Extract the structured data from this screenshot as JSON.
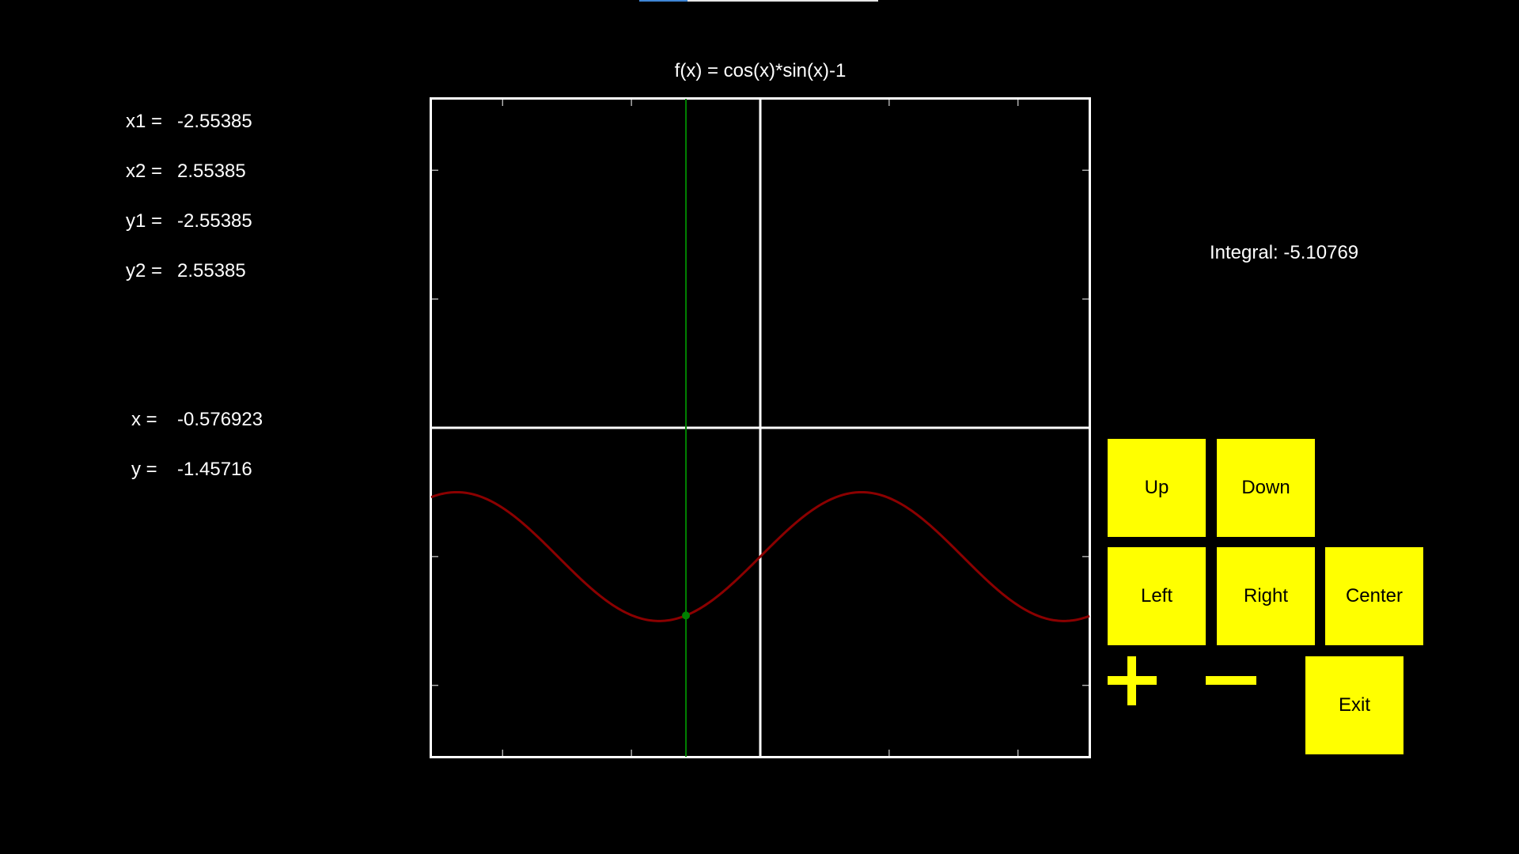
{
  "title": "f(x) = cos(x)*sin(x)-1",
  "range": {
    "x1_label": "x1 =",
    "x1": "-2.55385",
    "x2_label": "x2 =",
    "x2": "2.55385",
    "y1_label": "y1 =",
    "y1": "-2.55385",
    "y2_label": "y2 =",
    "y2": "2.55385"
  },
  "cursor": {
    "x_label": "x =",
    "x": "-0.576923",
    "y_label": "y =",
    "y": "-1.45716"
  },
  "integral": "Integral: -5.10769",
  "buttons": {
    "up": "Up",
    "down": "Down",
    "left": "Left",
    "right": "Right",
    "center": "Center",
    "exit": "Exit",
    "zoom_in_icon": "plus-icon",
    "zoom_out_icon": "minus-icon"
  },
  "colors": {
    "background": "#000000",
    "axes": "#ffffff",
    "curve": "#8b0000",
    "cursor_line": "#008000",
    "button": "#ffff00"
  },
  "chart_data": {
    "type": "line",
    "title": "f(x) = cos(x)*sin(x)-1",
    "xlim": [
      -2.55385,
      2.55385
    ],
    "ylim": [
      -2.55385,
      2.55385
    ],
    "series": [
      {
        "function": "cos(x)*sin(x)-1",
        "x": [
          -2.55385,
          -2.0,
          -1.5,
          -1.0,
          -0.785,
          -0.5,
          0.0,
          0.5,
          0.785,
          1.0,
          1.5,
          2.0,
          2.55385
        ],
        "values": [
          -0.5398,
          -0.6216,
          -1.0706,
          -1.4546,
          -1.5,
          -1.4207,
          -1.0,
          -0.5793,
          -0.5,
          -0.5454,
          -0.9294,
          -1.3784,
          -1.4602
        ]
      }
    ],
    "cursor": {
      "x": -0.576923,
      "y": -1.45716
    },
    "grid": false
  }
}
